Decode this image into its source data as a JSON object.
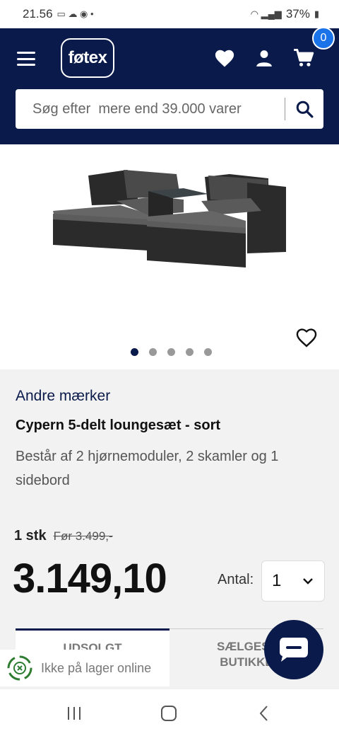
{
  "status_bar": {
    "time": "21.56",
    "battery": "37%"
  },
  "header": {
    "logo_text": "føtex",
    "cart_count": "0",
    "brand_color": "#0a1a4a",
    "badge_color": "#1a73e8"
  },
  "search": {
    "placeholder": "Søg efter  mere end 39.000 varer"
  },
  "gallery": {
    "image_description_icon": "lounge-set-product-image",
    "dot_count": 5,
    "active_dot": 0
  },
  "product": {
    "brand": "Andre mærker",
    "title": "Cypern 5-delt loungesæt - sort",
    "description": "Består af 2 hjørnemoduler, 2 skamler og 1 sidebord",
    "unit": "1 stk",
    "old_price": "Før 3.499,-",
    "price": "3.149,10",
    "quantity_label": "Antal:",
    "quantity_value": "1"
  },
  "tabs": [
    {
      "title": "UDSOLGT",
      "active": true
    },
    {
      "title": "SÆLGES I\nBUTIKKE",
      "active": false
    }
  ],
  "stock": {
    "text": "Ikke på lager online",
    "icon_color": "#2e7d32"
  },
  "system_nav": [
    "recent-apps",
    "home",
    "back"
  ]
}
